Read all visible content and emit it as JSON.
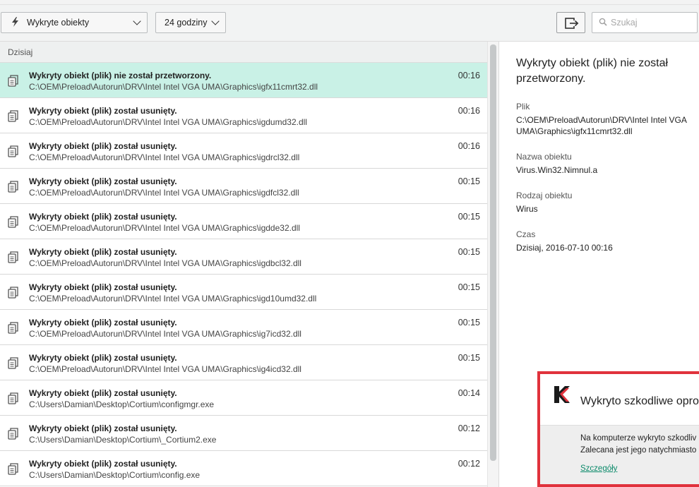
{
  "toolbar": {
    "filter_label": "Wykryte obiekty",
    "time_label": "24 godziny",
    "search_placeholder": "Szukaj",
    "icons": {
      "filter": "lightning-icon",
      "export": "export-icon",
      "search": "search-icon"
    }
  },
  "list": {
    "group_label": "Dzisiaj",
    "rows": [
      {
        "title": "Wykryty obiekt (plik) nie został przetworzony.",
        "path": "C:\\OEM\\Preload\\Autorun\\DRV\\Intel Intel VGA UMA\\Graphics\\igfx11cmrt32.dll",
        "time": "00:16",
        "selected": true
      },
      {
        "title": "Wykryty obiekt (plik) został usunięty.",
        "path": "C:\\OEM\\Preload\\Autorun\\DRV\\Intel Intel VGA UMA\\Graphics\\igdumd32.dll",
        "time": "00:16"
      },
      {
        "title": "Wykryty obiekt (plik) został usunięty.",
        "path": "C:\\OEM\\Preload\\Autorun\\DRV\\Intel Intel VGA UMA\\Graphics\\igdrcl32.dll",
        "time": "00:16"
      },
      {
        "title": "Wykryty obiekt (plik) został usunięty.",
        "path": "C:\\OEM\\Preload\\Autorun\\DRV\\Intel Intel VGA UMA\\Graphics\\igdfcl32.dll",
        "time": "00:15"
      },
      {
        "title": "Wykryty obiekt (plik) został usunięty.",
        "path": "C:\\OEM\\Preload\\Autorun\\DRV\\Intel Intel VGA UMA\\Graphics\\igdde32.dll",
        "time": "00:15"
      },
      {
        "title": "Wykryty obiekt (plik) został usunięty.",
        "path": "C:\\OEM\\Preload\\Autorun\\DRV\\Intel Intel VGA UMA\\Graphics\\igdbcl32.dll",
        "time": "00:15"
      },
      {
        "title": "Wykryty obiekt (plik) został usunięty.",
        "path": "C:\\OEM\\Preload\\Autorun\\DRV\\Intel Intel VGA UMA\\Graphics\\igd10umd32.dll",
        "time": "00:15"
      },
      {
        "title": "Wykryty obiekt (plik) został usunięty.",
        "path": "C:\\OEM\\Preload\\Autorun\\DRV\\Intel Intel VGA UMA\\Graphics\\ig7icd32.dll",
        "time": "00:15"
      },
      {
        "title": "Wykryty obiekt (plik) został usunięty.",
        "path": "C:\\OEM\\Preload\\Autorun\\DRV\\Intel Intel VGA UMA\\Graphics\\ig4icd32.dll",
        "time": "00:15"
      },
      {
        "title": "Wykryty obiekt (plik) został usunięty.",
        "path": "C:\\Users\\Damian\\Desktop\\Cortium\\configmgr.exe",
        "time": "00:14"
      },
      {
        "title": "Wykryty obiekt (plik) został usunięty.",
        "path": "C:\\Users\\Damian\\Desktop\\Cortium\\_Cortium2.exe",
        "time": "00:12"
      },
      {
        "title": "Wykryty obiekt (plik) został usunięty.",
        "path": "C:\\Users\\Damian\\Desktop\\Cortium\\config.exe",
        "time": "00:12"
      }
    ]
  },
  "detail": {
    "title": "Wykryty obiekt (plik) nie został przetworzony.",
    "file_label": "Plik",
    "file_value": "C:\\OEM\\Preload\\Autorun\\DRV\\Intel Intel VGA UMA\\Graphics\\igfx11cmrt32.dll",
    "name_label": "Nazwa obiektu",
    "name_value": "Virus.Win32.Nimnul.a",
    "type_label": "Rodzaj obiektu",
    "type_value": "Wirus",
    "time_label": "Czas",
    "time_value": "Dzisiaj, 2016-07-10 00:16"
  },
  "notification": {
    "title": "Wykryto szkodliwe opro",
    "line1": "Na komputerze wykryto szkodliv",
    "line2": "Zalecana jest jego natychmiasto",
    "link": "Szczegóły",
    "accent": "#e0323c"
  }
}
